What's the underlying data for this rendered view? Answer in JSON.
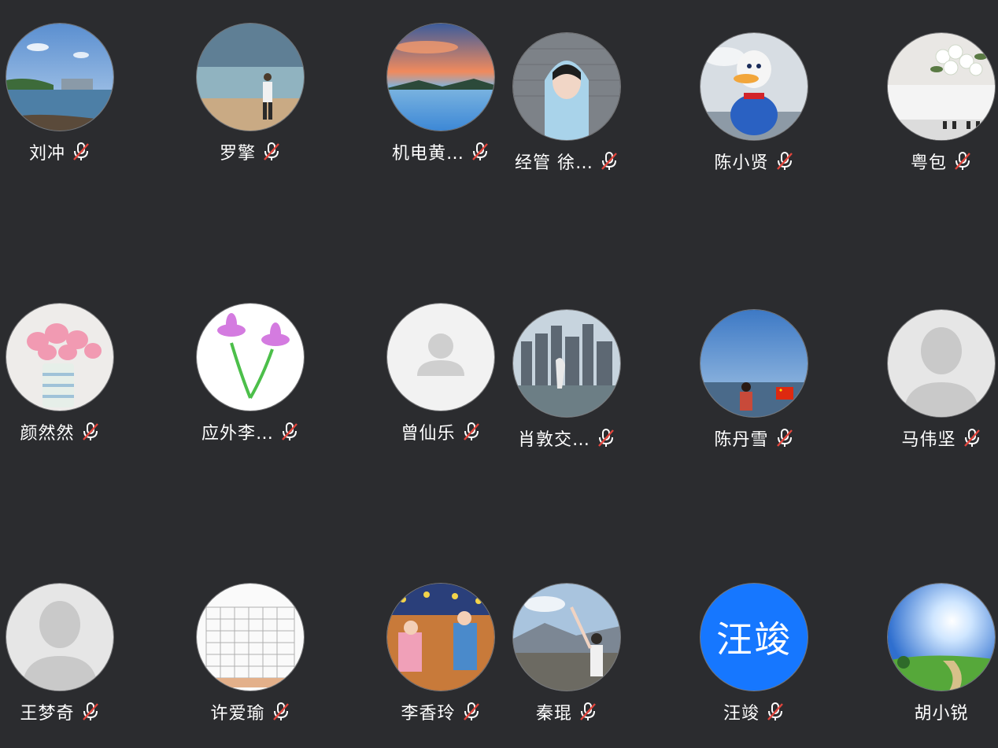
{
  "colors": {
    "background": "#2b2c2f",
    "name_text": "#ffffff",
    "mute_slash": "#e2453c",
    "text_avatar_blue": "#1677ff",
    "placeholder_bg": "#e6e6e6",
    "placeholder_silhouette": "#c9c9c9"
  },
  "participants": [
    {
      "name": "刘冲",
      "muted": true,
      "avatar": "lake-landscape"
    },
    {
      "name": "罗擎",
      "muted": true,
      "avatar": "beach-person"
    },
    {
      "name": "机电黄…",
      "muted": true,
      "avatar": "sunset-lake"
    },
    {
      "name": "经管 徐…",
      "muted": true,
      "avatar": "hooded-person"
    },
    {
      "name": "陈小贤",
      "muted": true,
      "avatar": "donald-duck-toy"
    },
    {
      "name": "粤包",
      "muted": true,
      "avatar": "piano-flowers"
    },
    {
      "name": "颜然然",
      "muted": true,
      "avatar": "pink-tulips-vase"
    },
    {
      "name": "应外李…",
      "muted": true,
      "avatar": "lotus-drawing"
    },
    {
      "name": "曾仙乐",
      "muted": true,
      "avatar": "default-user"
    },
    {
      "name": "肖敦交…",
      "muted": true,
      "avatar": "city-skyline"
    },
    {
      "name": "陈丹雪",
      "muted": true,
      "avatar": "seaside-woman"
    },
    {
      "name": "马伟坚",
      "muted": true,
      "avatar": "default-user-large"
    },
    {
      "name": "王梦奇",
      "muted": true,
      "avatar": "default-user-large"
    },
    {
      "name": "许爱瑜",
      "muted": true,
      "avatar": "periodic-table"
    },
    {
      "name": "李香玲",
      "muted": true,
      "avatar": "carousel-kids"
    },
    {
      "name": "秦琨",
      "muted": true,
      "avatar": "mountain-town"
    },
    {
      "name": "汪竣",
      "muted": true,
      "avatar": "text-avatar",
      "avatar_text": "汪竣"
    },
    {
      "name": "胡小锐",
      "muted": false,
      "avatar": "sunny-meadow"
    }
  ]
}
